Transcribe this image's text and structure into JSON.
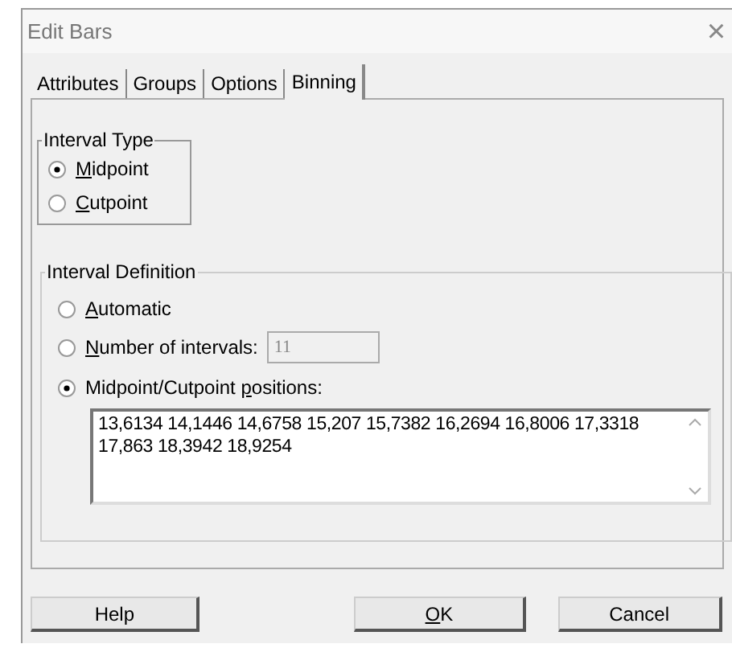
{
  "window": {
    "title": "Edit Bars",
    "close": "×"
  },
  "tabs": [
    {
      "label": "Attributes",
      "selected": false
    },
    {
      "label": "Groups",
      "selected": false
    },
    {
      "label": "Options",
      "selected": false
    },
    {
      "label": "Binning",
      "selected": true
    }
  ],
  "interval_type": {
    "title": "Interval Type",
    "options": [
      {
        "label": {
          "key": "M",
          "rest": "idpoint"
        },
        "selected": true
      },
      {
        "label": {
          "key": "C",
          "rest": "utpoint"
        },
        "selected": false
      }
    ]
  },
  "interval_definition": {
    "title": "Interval Definition",
    "options": [
      {
        "kind": "plain",
        "label": {
          "key": "A",
          "rest": "utomatic"
        },
        "selected": false
      },
      {
        "kind": "number",
        "label": {
          "key": "N",
          "rest": "umber of intervals:"
        },
        "selected": false,
        "value": "11",
        "disabled": true
      },
      {
        "kind": "list",
        "label": {
          "text": "Midpoint/Cutpoint ",
          "key": "p",
          "rest": "ositions:"
        },
        "selected": true,
        "value": "13,6134 14,1446 14,6758 15,207 15,7382 16,2694 16,8006 17,3318 17,863 18,3942 18,9254"
      }
    ]
  },
  "buttons": [
    {
      "label": {
        "rest": "Help"
      }
    },
    {
      "label": {
        "key": "O",
        "rest": "K"
      }
    },
    {
      "label": {
        "rest": "Cancel"
      }
    }
  ]
}
